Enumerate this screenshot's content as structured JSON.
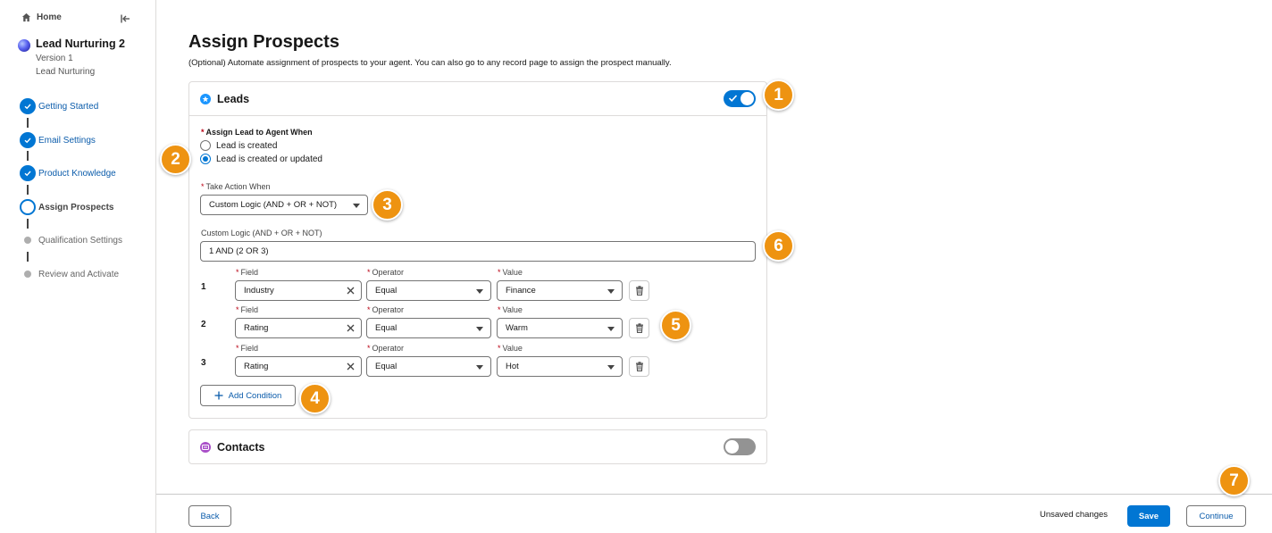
{
  "sidebar": {
    "home_label": "Home",
    "agent_name": "Lead Nurturing 2",
    "agent_version": "Version 1",
    "agent_type": "Lead Nurturing",
    "steps": [
      {
        "label": "Getting Started",
        "state": "done"
      },
      {
        "label": "Email Settings",
        "state": "done"
      },
      {
        "label": "Product Knowledge",
        "state": "done"
      },
      {
        "label": "Assign Prospects",
        "state": "current"
      },
      {
        "label": "Qualification Settings",
        "state": "future"
      },
      {
        "label": "Review and Activate",
        "state": "future"
      }
    ]
  },
  "page": {
    "title": "Assign Prospects",
    "description": "(Optional) Automate assignment of prospects to your agent. You can also go to any record page to assign the prospect manually."
  },
  "leads": {
    "title": "Leads",
    "enabled": true,
    "assign_when_label": "Assign Lead to Agent When",
    "radio_options": [
      "Lead is created",
      "Lead is created or updated"
    ],
    "selected_option": "Lead is created or updated",
    "take_action_label": "Take Action When",
    "take_action_value": "Custom Logic (AND + OR + NOT)",
    "custom_logic_label": "Custom Logic (AND + OR + NOT)",
    "custom_logic_value": "1 AND (2 OR 3)",
    "field_label": "Field",
    "operator_label": "Operator",
    "value_label": "Value",
    "conditions": [
      {
        "num": "1",
        "field": "Industry",
        "operator": "Equal",
        "value": "Finance"
      },
      {
        "num": "2",
        "field": "Rating",
        "operator": "Equal",
        "value": "Warm"
      },
      {
        "num": "3",
        "field": "Rating",
        "operator": "Equal",
        "value": "Hot"
      }
    ],
    "add_condition_label": "Add Condition"
  },
  "contacts": {
    "title": "Contacts",
    "enabled": false
  },
  "footer": {
    "back_label": "Back",
    "unsaved_text": "Unsaved changes",
    "save_label": "Save",
    "continue_label": "Continue"
  },
  "callouts": [
    "1",
    "2",
    "3",
    "4",
    "5",
    "6",
    "7"
  ],
  "colors": {
    "brand": "#0176d3",
    "callout": "#ee9311",
    "required": "#ba0517",
    "contact_icon": "#a94fc8",
    "lead_icon": "#1b96ff"
  },
  "icons": [
    "home-icon",
    "collapse-sidebar-icon",
    "agent-orb-icon",
    "check-icon",
    "lead-icon",
    "contact-icon",
    "clear-icon",
    "trash-icon",
    "plus-icon",
    "dropdown-caret-icon"
  ]
}
